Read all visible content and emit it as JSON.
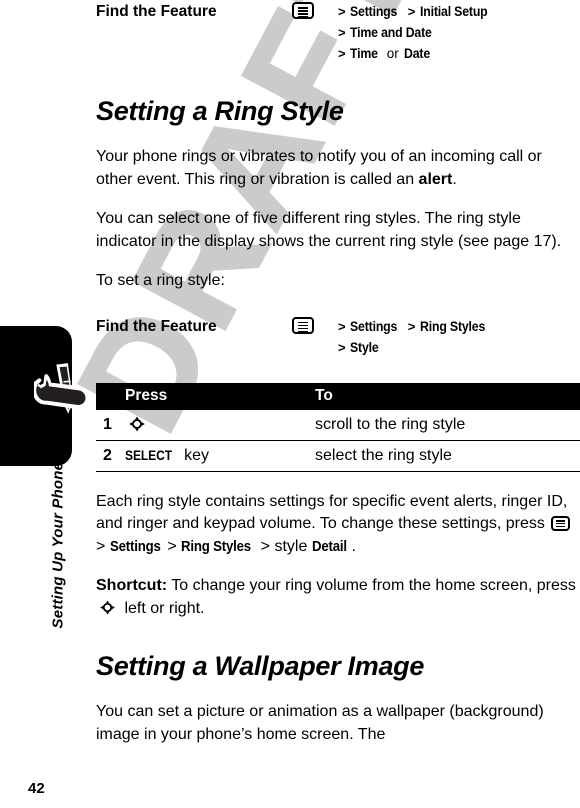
{
  "page": {
    "number": "42",
    "chapter": "Setting Up Your Phone",
    "watermark": "DRAFT",
    "accent_color": "#000000",
    "watermark_color": "#c9c9c9"
  },
  "find_feature_1": {
    "label": "Find the Feature",
    "key_icon": "menu-key-icon",
    "lines": [
      {
        "gt": ">",
        "parts": [
          {
            "text": "Settings",
            "bold": true
          },
          {
            "text": ">",
            "gt": true
          },
          {
            "text": "Initial Setup",
            "bold": true
          }
        ]
      },
      {
        "gt": ">",
        "parts": [
          {
            "text": "Time and Date",
            "bold": true
          }
        ]
      },
      {
        "gt": ">",
        "parts": [
          {
            "text": "Time",
            "bold": true
          },
          {
            "text": "or",
            "bold": false
          },
          {
            "text": "Date",
            "bold": true
          }
        ]
      }
    ],
    "line1_a": "Settings",
    "line1_b": "Initial Setup",
    "line2_a": "Time and Date",
    "line3_a": "Time",
    "line3_or": "or",
    "line3_b": "Date",
    "gt": ">"
  },
  "heading_ring_style": "Setting a Ring Style",
  "para_1_pre": "Your phone rings or vibrates to notify you of an incoming call or other event. This ring or vibration is called an ",
  "para_1_bold": "alert",
  "para_1_post": ".",
  "para_2": "You can select one of five different ring styles. The ring style indicator in the display shows the current ring style (see page 17).",
  "para_3": "To set a ring style:",
  "find_feature_2": {
    "label": "Find the Feature",
    "key_icon": "menu-key-icon",
    "line1_a": "Settings",
    "line1_b": "Ring Styles",
    "line2_a": "Style",
    "gt": ">"
  },
  "steps_table": {
    "headers": {
      "num": "",
      "press": "Press",
      "to": "To"
    },
    "rows": [
      {
        "num": "1",
        "press_icon": "nav-key-icon",
        "press": "",
        "press_suffix": "",
        "to": "scroll to the ring style"
      },
      {
        "num": "2",
        "press_icon": "",
        "press": "SELECT",
        "press_suffix": "key",
        "to": "select the ring style"
      }
    ]
  },
  "para_4_pre": "Each ring style contains settings for specific event alerts, ringer ID, and ringer and keypad volume. To change these settings, press ",
  "para_4_gt1": ">",
  "para_4_b1": "Settings",
  "para_4_gt2": ">",
  "para_4_b2": "Ring Styles",
  "para_4_gt3": ">",
  "para_4_mid": "style",
  "para_4_b3": "Detail",
  "para_4_end": ".",
  "para_5_bold": "Shortcut:",
  "para_5_pre": " To change your ring volume from the home screen, press ",
  "para_5_post": " left or right.",
  "heading_wallpaper": "Setting a Wallpaper Image",
  "para_6": "You can set a picture or animation as a wallpaper (background) image in your phone’s home screen. The"
}
